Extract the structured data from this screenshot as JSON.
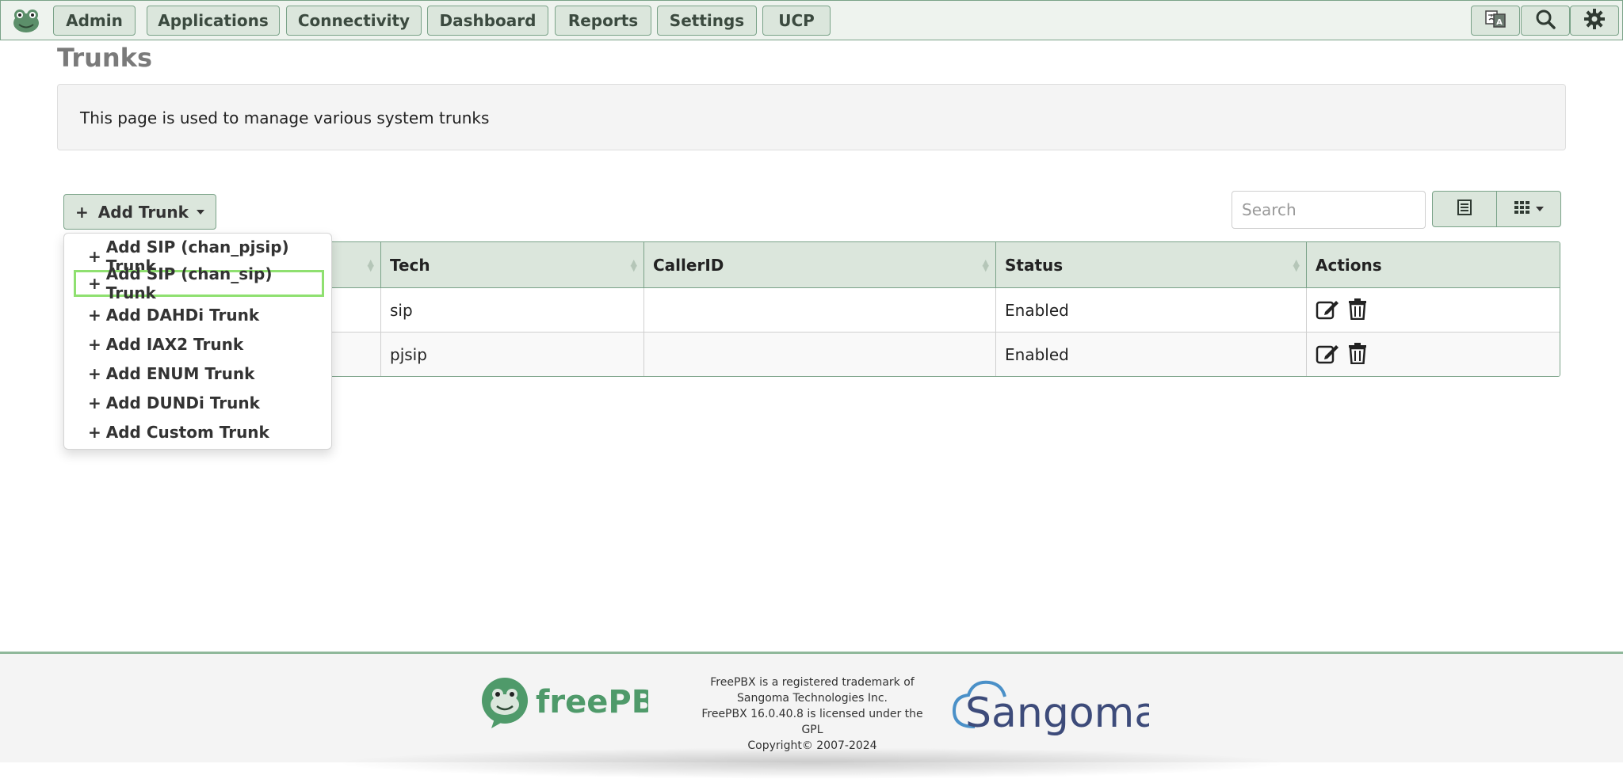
{
  "nav": {
    "items": [
      "Admin",
      "Applications",
      "Connectivity",
      "Dashboard",
      "Reports",
      "Settings",
      "UCP"
    ]
  },
  "page": {
    "title": "Trunks",
    "description": "This page is used to manage various system trunks"
  },
  "toolbar": {
    "add_trunk_label": "Add Trunk",
    "search_placeholder": "Search"
  },
  "dropdown": {
    "items": [
      "Add SIP (chan_pjsip) Trunk",
      "Add SIP (chan_sip) Trunk",
      "Add DAHDi Trunk",
      "Add IAX2 Trunk",
      "Add ENUM Trunk",
      "Add DUNDi Trunk",
      "Add Custom Trunk"
    ],
    "highlighted_index": 1
  },
  "table": {
    "columns": [
      "Tech",
      "CallerID",
      "Status",
      "Actions"
    ],
    "rows": [
      {
        "tech": "sip",
        "callerid": "",
        "status": "Enabled"
      },
      {
        "tech": "pjsip",
        "callerid": "",
        "status": "Enabled"
      }
    ]
  },
  "footer": {
    "brand_left": "freePBX",
    "brand_right": "Sangoma",
    "lines": [
      "FreePBX is a registered trademark of",
      "Sangoma Technologies Inc.",
      "FreePBX 16.0.40.8 is licensed under the",
      "GPL",
      "Copyright© 2007-2024"
    ]
  },
  "colors": {
    "nav_bg": "#dbe6dc",
    "nav_border": "#7aa288",
    "highlight": "#8fe070",
    "brand_green": "#4f9a6a",
    "brand_navy": "#3d4b7a"
  }
}
